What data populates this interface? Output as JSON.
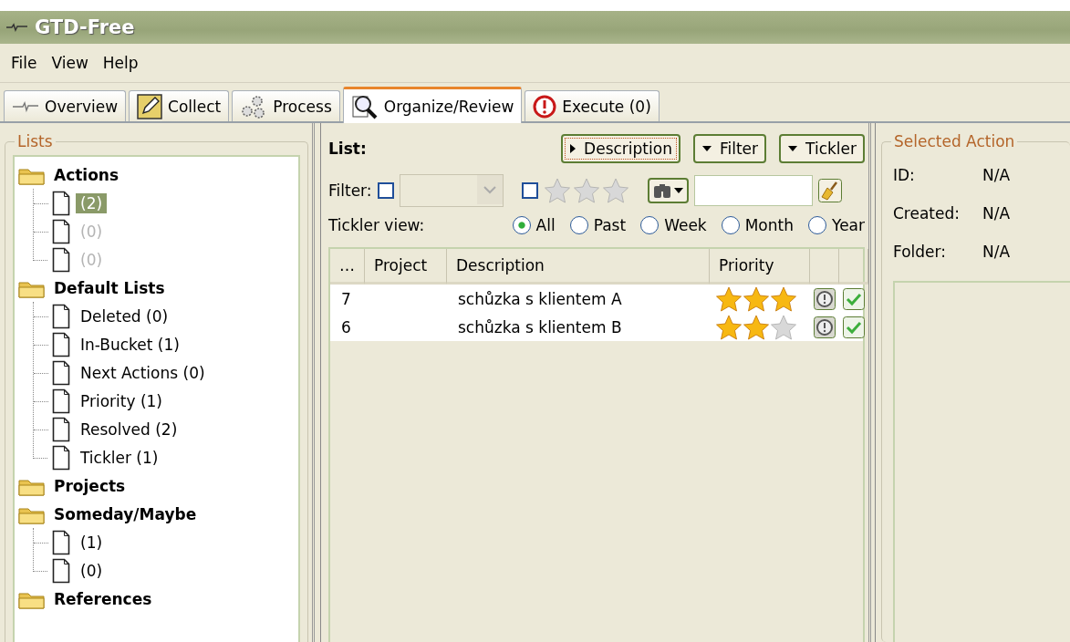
{
  "window": {
    "title": "GTD-Free"
  },
  "menu": [
    "File",
    "View",
    "Help"
  ],
  "tabs": [
    {
      "label": "Overview",
      "selected": false
    },
    {
      "label": "Collect",
      "selected": false
    },
    {
      "label": "Process",
      "selected": false
    },
    {
      "label": "Organize/Review",
      "selected": true
    },
    {
      "label": "Execute (0)",
      "selected": false
    }
  ],
  "lists_panel": {
    "title": "Lists",
    "tree": [
      {
        "label": "Actions",
        "selected": false,
        "children": [
          {
            "label": "(2)",
            "selected": true,
            "disabled": false
          },
          {
            "label": "(0)",
            "selected": false,
            "disabled": true
          },
          {
            "label": "(0)",
            "selected": false,
            "disabled": true
          }
        ]
      },
      {
        "label": "Default Lists",
        "selected": false,
        "children": [
          {
            "label": "Deleted (0)",
            "selected": false,
            "disabled": false
          },
          {
            "label": "In-Bucket (1)",
            "selected": false,
            "disabled": false
          },
          {
            "label": "Next Actions (0)",
            "selected": false,
            "disabled": false
          },
          {
            "label": "Priority (1)",
            "selected": false,
            "disabled": false
          },
          {
            "label": "Resolved (2)",
            "selected": false,
            "disabled": false
          },
          {
            "label": "Tickler (1)",
            "selected": false,
            "disabled": false
          }
        ]
      },
      {
        "label": "Projects",
        "selected": false
      },
      {
        "label": "Someday/Maybe",
        "selected": false,
        "children": [
          {
            "label": "(1)",
            "selected": false,
            "disabled": false
          },
          {
            "label": "(0)",
            "selected": false,
            "disabled": false
          }
        ]
      },
      {
        "label": "References",
        "selected": false
      }
    ]
  },
  "list_panel": {
    "label": "List:",
    "buttons": [
      {
        "label": "Description",
        "expanded": false,
        "focused": true
      },
      {
        "label": "Filter",
        "expanded": true,
        "focused": false
      },
      {
        "label": "Tickler",
        "expanded": true,
        "focused": false
      }
    ],
    "filter": {
      "label": "Filter:",
      "folder_checked": false,
      "priority_checked": false,
      "stars": 0
    },
    "tickler": {
      "label": "Tickler view:",
      "options": [
        {
          "label": "All",
          "selected": true
        },
        {
          "label": "Past",
          "selected": false
        },
        {
          "label": "Week",
          "selected": false
        },
        {
          "label": "Month",
          "selected": false
        },
        {
          "label": "Year",
          "selected": false
        }
      ]
    },
    "table": {
      "columns": [
        "…",
        "Project",
        "Description",
        "Priority"
      ],
      "rows": [
        {
          "column_1": "7",
          "description": "schůzka s klientem A",
          "stars": 3
        },
        {
          "column_1": "6",
          "description": "schůzka s klientem B",
          "stars": 2
        }
      ]
    }
  },
  "selected_action": {
    "title": "Selected Action",
    "fields": [
      {
        "label": "ID:",
        "value": "N/A"
      },
      {
        "label": "Created:",
        "value": "N/A"
      },
      {
        "label": "Folder:",
        "value": "N/A"
      }
    ]
  }
}
